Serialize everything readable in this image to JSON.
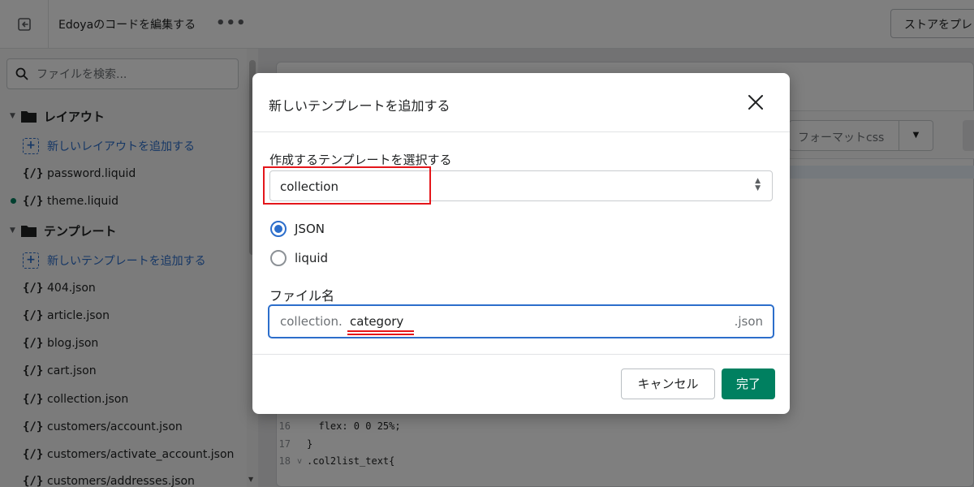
{
  "topbar": {
    "exit_icon": "exit-icon",
    "title": "Edoyaのコードを編集する",
    "more_label": "•••",
    "preview_label": "ストアをプレビュー"
  },
  "sidebar": {
    "search_placeholder": "ファイルを検索...",
    "folders": [
      {
        "name": "レイアウト",
        "add_label": "新しいレイアウトを追加する",
        "files": [
          "password.liquid",
          "theme.liquid"
        ]
      },
      {
        "name": "テンプレート",
        "add_label": "新しいテンプレートを追加する",
        "files": [
          "404.json",
          "article.json",
          "blog.json",
          "cart.json",
          "collection.json",
          "customers/account.json",
          "customers/activate_account.json",
          "customers/addresses.json"
        ]
      }
    ],
    "code_icon_glyph": "{/}"
  },
  "editor": {
    "format_label": "フォーマットcss",
    "code_lines": [
      {
        "num": "16",
        "fold": "",
        "text": "  flex: 0 0 25%;"
      },
      {
        "num": "17",
        "fold": "",
        "text": "}"
      },
      {
        "num": "18",
        "fold": "v",
        "text": ".col2list_text{"
      }
    ]
  },
  "modal": {
    "title": "新しいテンプレートを追加する",
    "select_label": "作成するテンプレートを選択する",
    "select_value": "collection",
    "radio_options": [
      {
        "label": "JSON",
        "checked": true
      },
      {
        "label": "liquid",
        "checked": false
      }
    ],
    "filename_label": "ファイル名",
    "filename_prefix": "collection.",
    "filename_value": "category",
    "filename_suffix": ".json",
    "cancel_label": "キャンセル",
    "done_label": "完了"
  },
  "colors": {
    "primary_green": "#008060",
    "link_blue": "#2c6ecb",
    "annotation_red": "#e4161b"
  }
}
